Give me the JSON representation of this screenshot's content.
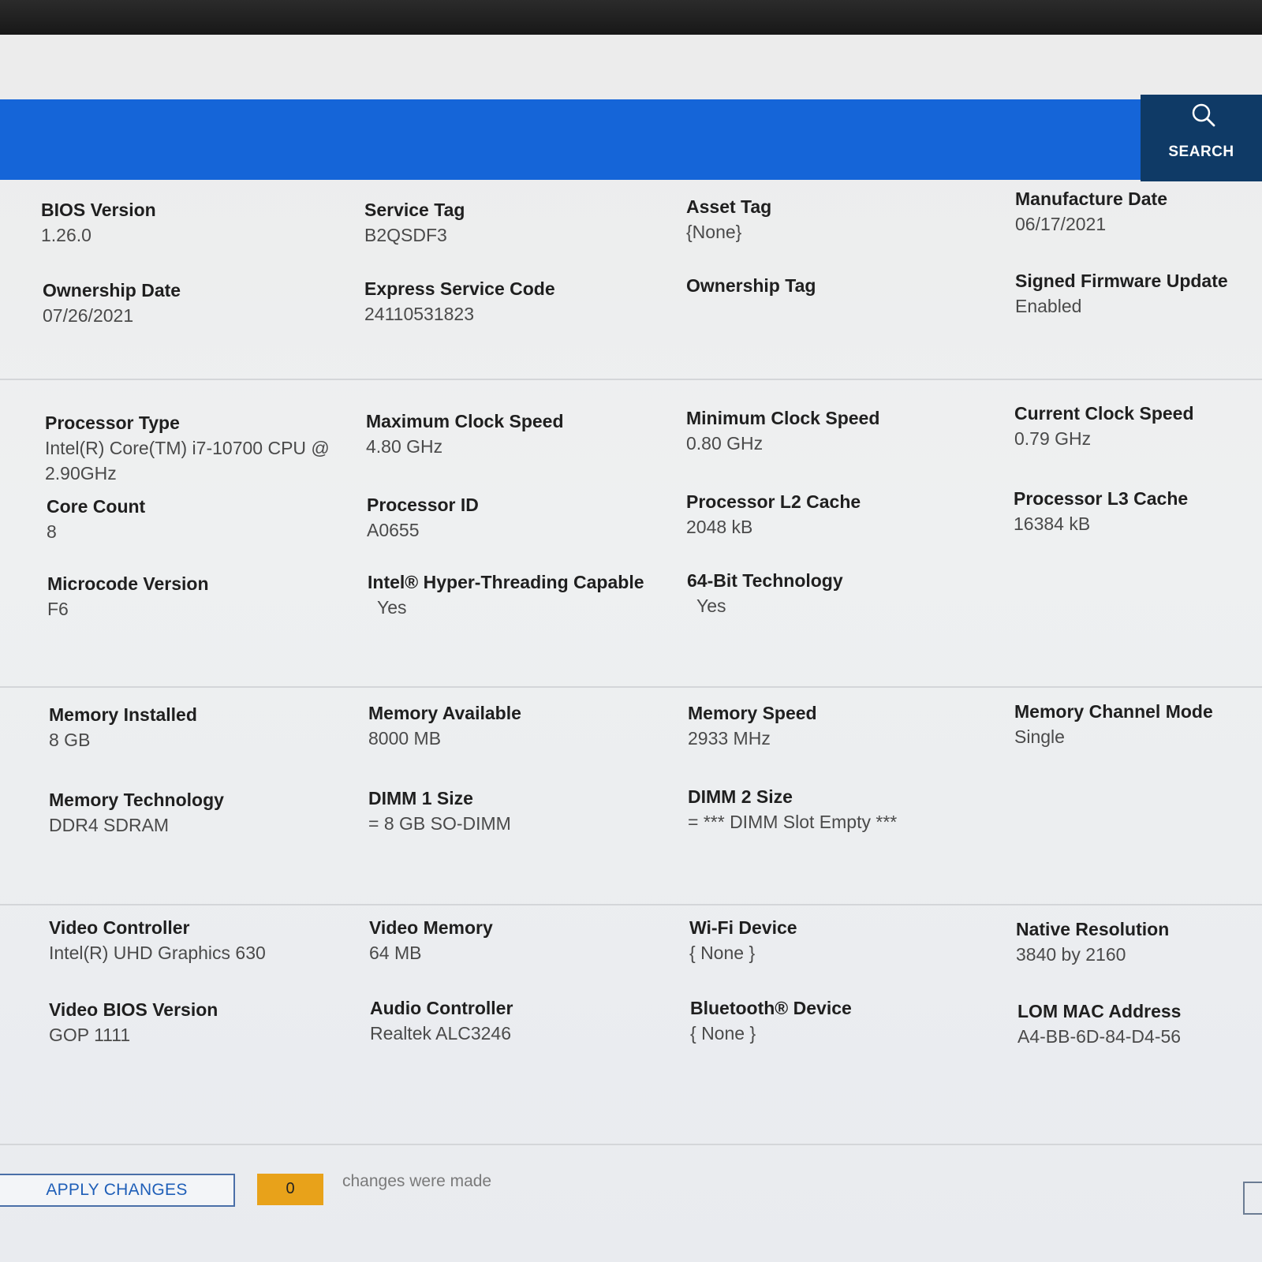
{
  "search": {
    "label": "SEARCH",
    "icon": "search-icon"
  },
  "colors": {
    "header_bar": "#1565d8",
    "search_bg": "#0f3a66",
    "badge": "#e8a21a"
  },
  "sections": [
    {
      "name": "system",
      "rows": [
        [
          {
            "label": "BIOS Version",
            "value": "1.26.0"
          },
          {
            "label": "Service Tag",
            "value": "B2QSDF3"
          },
          {
            "label": "Asset Tag",
            "value": "{None}"
          },
          {
            "label": "Manufacture Date",
            "value": "06/17/2021"
          }
        ],
        [
          {
            "label": "Ownership Date",
            "value": "07/26/2021"
          },
          {
            "label": "Express Service Code",
            "value": "24110531823"
          },
          {
            "label": "Ownership Tag",
            "value": ""
          },
          {
            "label": "Signed Firmware Update",
            "value": "Enabled"
          }
        ]
      ]
    },
    {
      "name": "processor",
      "rows": [
        [
          {
            "label": "Processor Type",
            "value": "Intel(R) Core(TM) i7-10700 CPU @ 2.90GHz"
          },
          {
            "label": "Maximum Clock Speed",
            "value": "4.80 GHz"
          },
          {
            "label": "Minimum Clock Speed",
            "value": "0.80 GHz"
          },
          {
            "label": "Current Clock Speed",
            "value": "0.79 GHz"
          }
        ],
        [
          {
            "label": "Core Count",
            "value": "8"
          },
          {
            "label": "Processor ID",
            "value": "A0655"
          },
          {
            "label": "Processor L2 Cache",
            "value": "2048 kB"
          },
          {
            "label": "Processor L3 Cache",
            "value": "16384 kB"
          }
        ],
        [
          {
            "label": "Microcode Version",
            "value": "F6"
          },
          {
            "label": "Intel® Hyper-Threading Capable",
            "value": "Yes"
          },
          {
            "label": "64-Bit Technology",
            "value": "Yes"
          }
        ]
      ]
    },
    {
      "name": "memory",
      "rows": [
        [
          {
            "label": "Memory Installed",
            "value": "8 GB"
          },
          {
            "label": "Memory Available",
            "value": "8000 MB"
          },
          {
            "label": "Memory Speed",
            "value": "2933 MHz"
          },
          {
            "label": "Memory Channel Mode",
            "value": "Single"
          }
        ],
        [
          {
            "label": "Memory Technology",
            "value": "DDR4 SDRAM"
          },
          {
            "label": "DIMM 1 Size",
            "value": "= 8 GB SO-DIMM"
          },
          {
            "label": "DIMM 2 Size",
            "value": "= *** DIMM Slot Empty ***"
          }
        ]
      ]
    },
    {
      "name": "devices",
      "rows": [
        [
          {
            "label": "Video Controller",
            "value": "Intel(R) UHD Graphics 630"
          },
          {
            "label": "Video Memory",
            "value": "64 MB"
          },
          {
            "label": "Wi-Fi Device",
            "value": "{ None }"
          },
          {
            "label": "Native Resolution",
            "value": "3840 by 2160"
          }
        ],
        [
          {
            "label": "Video BIOS Version",
            "value": "GOP 1111"
          },
          {
            "label": "Audio Controller",
            "value": "Realtek ALC3246"
          },
          {
            "label": "Bluetooth® Device",
            "value": "{ None }"
          },
          {
            "label": "LOM MAC Address",
            "value": "A4-BB-6D-84-D4-56"
          }
        ]
      ]
    }
  ],
  "footer": {
    "apply_label": "APPLY CHANGES",
    "change_count": "0",
    "changes_text": "changes were made"
  }
}
